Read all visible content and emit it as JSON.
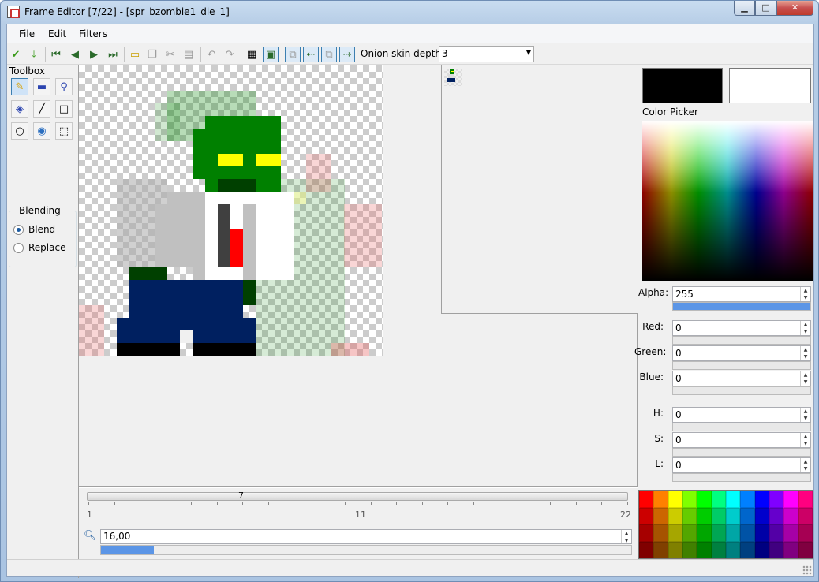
{
  "window": {
    "title": "Frame Editor [7/22] - [spr_bzombie1_die_1]",
    "minimize": "▁",
    "maximize": "□",
    "close": "✕"
  },
  "menu": {
    "items": [
      "File",
      "Edit",
      "Filters"
    ]
  },
  "toolbar": {
    "icons": [
      "check-icon",
      "download-icon",
      "frame-first-icon",
      "frame-prev-icon",
      "frame-next-icon",
      "frame-last-icon",
      "new-icon",
      "copy-icon",
      "cut-icon",
      "paste-icon",
      "undo-icon",
      "redo-icon",
      "grid-icon",
      "onion-toggle-icon",
      "onion-back-icon",
      "onion-prev-icon",
      "onion-next-icon",
      "onion-forward-icon"
    ],
    "onion_label": "Onion skin depth:",
    "onion_value": "3"
  },
  "toolbox": {
    "label": "Toolbox",
    "tools": [
      "pencil-icon",
      "rectangle-fill-icon",
      "eyedropper-icon",
      "bucket-fill-icon",
      "line-icon",
      "rectangle-icon",
      "ellipse-icon",
      "pattern-fill-icon",
      "selection-icon"
    ],
    "selected": 0
  },
  "blending": {
    "label": "Blending",
    "options": [
      "Blend",
      "Replace"
    ],
    "selected": "Blend"
  },
  "color": {
    "primary": "#000000",
    "secondary": "#ffffff",
    "picker_label": "Color Picker",
    "alpha_label": "Alpha:",
    "alpha": "255",
    "red_label": "Red:",
    "red": "0",
    "green_label": "Green:",
    "green": "0",
    "blue_label": "Blue:",
    "blue": "0",
    "h_label": "H:",
    "h": "0",
    "s_label": "S:",
    "s": "0",
    "l_label": "L:",
    "l": "0"
  },
  "timeline": {
    "current": "7",
    "min": "1",
    "mid": "11",
    "max": "22"
  },
  "zoom": {
    "value": "16,00",
    "fill": 0.1
  },
  "palette": [
    "#ff0000",
    "#ff8000",
    "#ffff00",
    "#80ff00",
    "#00ff00",
    "#00ff80",
    "#00ffff",
    "#0080ff",
    "#0000ff",
    "#8000ff",
    "#ff00ff",
    "#ff0080"
  ]
}
